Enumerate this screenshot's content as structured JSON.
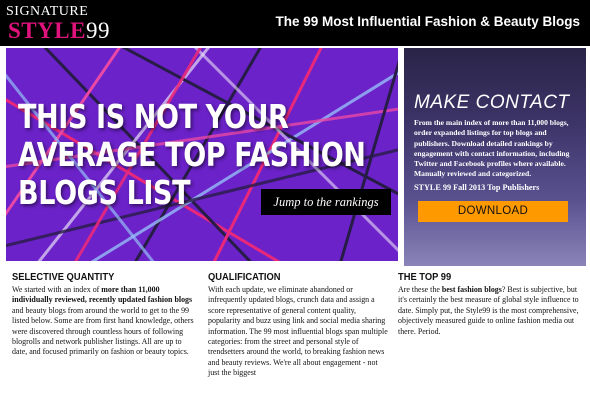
{
  "header": {
    "logo_signature": "Signature",
    "logo_brand": "STYLE",
    "logo_number": "99",
    "site_title": "The 99 Most Influential Fashion & Beauty Blogs"
  },
  "hero": {
    "headline_lines": [
      "THIS IS NOT YOUR",
      "AVERAGE TOP FASHION",
      "BLOGS LIST"
    ],
    "jump_label": "Jump to the rankings",
    "background_color": "#6b22c9"
  },
  "contact": {
    "title": "MAKE CONTACT",
    "body": "From the main index of more than 11,000 blogs, order expanded listings for top blogs and publishers. Download detailed rankings by engagement with contact information, including Twitter and Facebook profiles where available. Manually reviewed and categorized.",
    "subtitle": "STYLE 99 Fall 2013 Top Publishers",
    "download_label": "DOWNLOAD",
    "button_color": "#ff9900"
  },
  "columns": [
    {
      "heading": "Selective Quantity",
      "body_parts": [
        {
          "text": "We started with an index of ",
          "bold": false
        },
        {
          "text": "more than 11,000 individually reviewed, recently updated fashion blogs",
          "bold": true
        },
        {
          "text": " and beauty blogs from around the world to get to the 99 listed below. Some are from first hand knowledge, others were discovered through countless hours of following blogrolls and network publisher listings. All are up to date, and focused primarily on fashion or beauty topics.",
          "bold": false
        }
      ]
    },
    {
      "heading": "Qualification",
      "body_parts": [
        {
          "text": "With each update, we eliminate abandoned or infrequently updated blogs, crunch data and assign a score representative of general content quality, popularity and buzz using link and social media sharing information. The 99 most influential blogs span multiple categories: from the street and personal style of trendsetters around the world, to breaking fashion news and beauty reviews. We're all about engagement - not just the biggest",
          "bold": false
        }
      ]
    },
    {
      "heading": "The Top 99",
      "body_parts": [
        {
          "text": "Are these the ",
          "bold": false
        },
        {
          "text": "best fashion blogs",
          "bold": true
        },
        {
          "text": "? Best is subjective, but it's certainly the best measure of global style influence to date. Simply put, the Style99 is the most comprehensive, objectively measured guide to online fashion media out there. Period.",
          "bold": false
        }
      ]
    }
  ]
}
